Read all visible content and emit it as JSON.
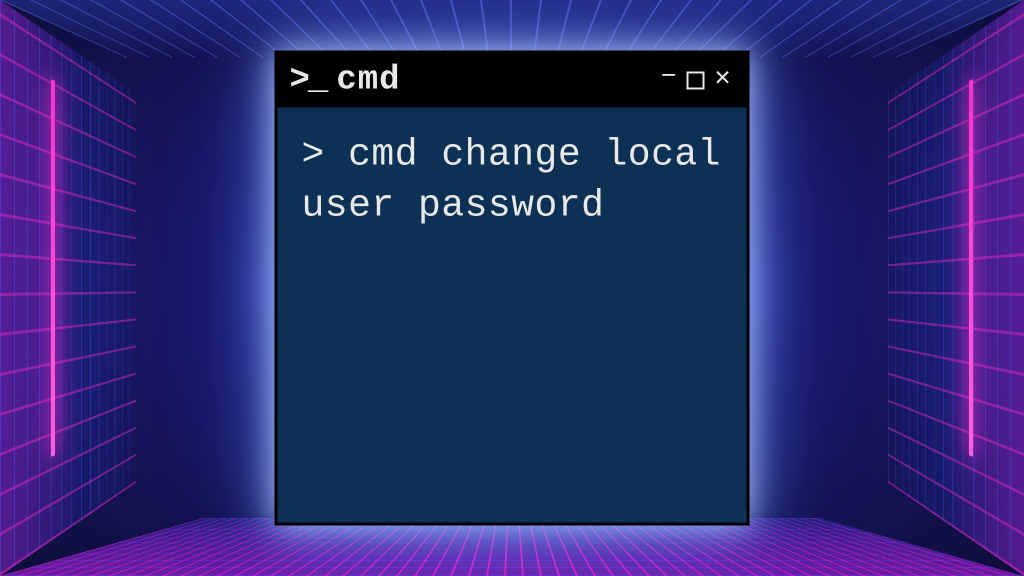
{
  "window": {
    "title": "cmd",
    "prompt_icon": ">_"
  },
  "terminal": {
    "prompt": ">",
    "command": "cmd change local user password"
  },
  "controls": {
    "minimize": "−",
    "close": "×"
  }
}
